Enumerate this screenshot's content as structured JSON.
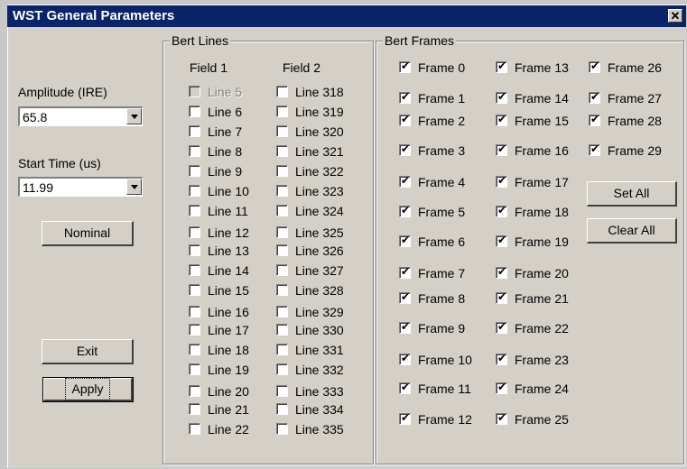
{
  "window": {
    "title": "WST General Parameters",
    "close_glyph": "✕"
  },
  "left": {
    "amplitude_label": "Amplitude (IRE)",
    "amplitude_value": "65.8",
    "start_time_label": "Start Time (us)",
    "start_time_value": "11.99",
    "nominal_label": "Nominal",
    "exit_label": "Exit",
    "apply_label": "Apply"
  },
  "bert_lines": {
    "title": "Bert Lines",
    "field1_header": "Field 1",
    "field2_header": "Field 2",
    "field1": [
      {
        "label": "Line 5",
        "checked": false,
        "disabled": true
      },
      {
        "label": "Line 6",
        "checked": false
      },
      {
        "label": "Line 7",
        "checked": false
      },
      {
        "label": "Line 8",
        "checked": false
      },
      {
        "label": "Line 9",
        "checked": false
      },
      {
        "label": "Line 10",
        "checked": false
      },
      {
        "label": "Line 11",
        "checked": false
      },
      {
        "label": "Line 12",
        "checked": false
      },
      {
        "label": "Line 13",
        "checked": false
      },
      {
        "label": "Line 14",
        "checked": false
      },
      {
        "label": "Line 15",
        "checked": false
      },
      {
        "label": "Line 16",
        "checked": false
      },
      {
        "label": "Line 17",
        "checked": false
      },
      {
        "label": "Line 18",
        "checked": false
      },
      {
        "label": "Line 19",
        "checked": false
      },
      {
        "label": "Line 20",
        "checked": false
      },
      {
        "label": "Line 21",
        "checked": false
      },
      {
        "label": "Line 22",
        "checked": false
      }
    ],
    "field2": [
      {
        "label": "Line 318",
        "checked": false
      },
      {
        "label": "Line 319",
        "checked": false
      },
      {
        "label": "Line 320",
        "checked": false
      },
      {
        "label": "Line 321",
        "checked": false
      },
      {
        "label": "Line 322",
        "checked": false
      },
      {
        "label": "Line 323",
        "checked": false
      },
      {
        "label": "Line 324",
        "checked": false
      },
      {
        "label": "Line 325",
        "checked": false
      },
      {
        "label": "Line 326",
        "checked": false
      },
      {
        "label": "Line 327",
        "checked": false
      },
      {
        "label": "Line 328",
        "checked": false
      },
      {
        "label": "Line 329",
        "checked": false
      },
      {
        "label": "Line 330",
        "checked": false
      },
      {
        "label": "Line 331",
        "checked": false
      },
      {
        "label": "Line 332",
        "checked": false
      },
      {
        "label": "Line 333",
        "checked": false
      },
      {
        "label": "Line 334",
        "checked": false
      },
      {
        "label": "Line 335",
        "checked": false
      }
    ]
  },
  "bert_frames": {
    "title": "Bert Frames",
    "col1": [
      {
        "label": "Frame 0",
        "checked": true
      },
      {
        "label": "Frame 1",
        "checked": true
      },
      {
        "label": "Frame 2",
        "checked": true
      },
      {
        "label": "Frame 3",
        "checked": true
      },
      {
        "label": "Frame 4",
        "checked": true
      },
      {
        "label": "Frame 5",
        "checked": true
      },
      {
        "label": "Frame 6",
        "checked": true
      },
      {
        "label": "Frame 7",
        "checked": true
      },
      {
        "label": "Frame 8",
        "checked": true
      },
      {
        "label": "Frame 9",
        "checked": true
      },
      {
        "label": "Frame 10",
        "checked": true
      },
      {
        "label": "Frame 11",
        "checked": true
      },
      {
        "label": "Frame 12",
        "checked": true
      }
    ],
    "col2": [
      {
        "label": "Frame 13",
        "checked": true
      },
      {
        "label": "Frame 14",
        "checked": true
      },
      {
        "label": "Frame 15",
        "checked": true
      },
      {
        "label": "Frame 16",
        "checked": true
      },
      {
        "label": "Frame 17",
        "checked": true
      },
      {
        "label": "Frame 18",
        "checked": true
      },
      {
        "label": "Frame 19",
        "checked": true
      },
      {
        "label": "Frame 20",
        "checked": true
      },
      {
        "label": "Frame 21",
        "checked": true
      },
      {
        "label": "Frame 22",
        "checked": true
      },
      {
        "label": "Frame 23",
        "checked": true
      },
      {
        "label": "Frame 24",
        "checked": true
      },
      {
        "label": "Frame 25",
        "checked": true
      }
    ],
    "col3": [
      {
        "label": "Frame 26",
        "checked": true
      },
      {
        "label": "Frame 27",
        "checked": true
      },
      {
        "label": "Frame 28",
        "checked": true
      },
      {
        "label": "Frame 29",
        "checked": true
      }
    ],
    "set_all_label": "Set All",
    "clear_all_label": "Clear All"
  },
  "colors": {
    "titlebar": "#0a246a",
    "face": "#d4d0c8"
  }
}
